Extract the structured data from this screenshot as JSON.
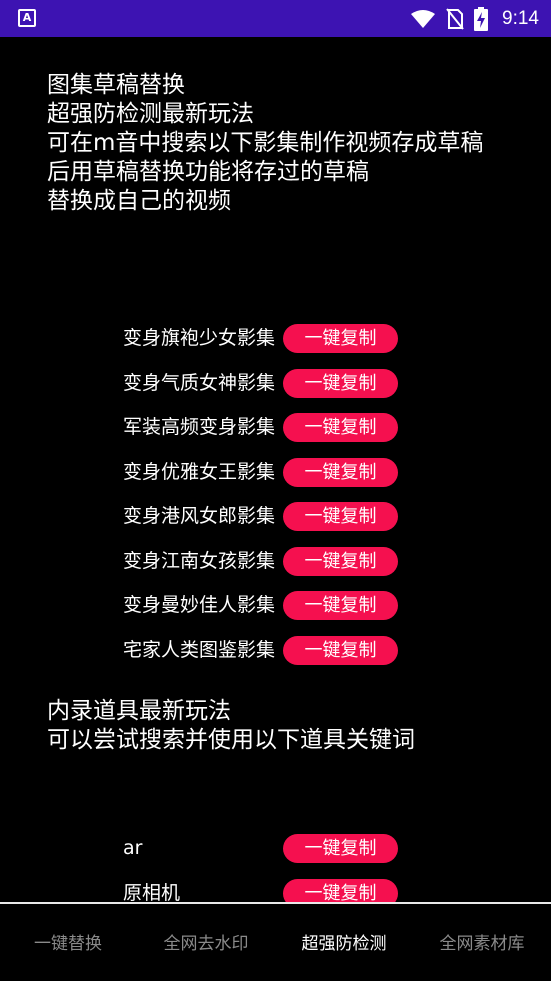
{
  "status_bar": {
    "app_icon_letter": "A",
    "time": "9:14",
    "background": "#3d13b2",
    "icons": [
      "wifi-icon",
      "no-sim-icon",
      "battery-charging-icon"
    ]
  },
  "intro_text": "图集草稿替换\n超强防检测最新玩法\n可在m音中搜索以下影集制作视频存成草稿\n后用草稿替换功能将存过的草稿\n替换成自己的视频",
  "album_rows": [
    {
      "label": "变身旗袍少女影集",
      "button": "一键复制"
    },
    {
      "label": "变身气质女神影集",
      "button": "一键复制"
    },
    {
      "label": "军装高频变身影集",
      "button": "一键复制"
    },
    {
      "label": "变身优雅女王影集",
      "button": "一键复制"
    },
    {
      "label": "变身港风女郎影集",
      "button": "一键复制"
    },
    {
      "label": "变身江南女孩影集",
      "button": "一键复制"
    },
    {
      "label": "变身曼妙佳人影集",
      "button": "一键复制"
    },
    {
      "label": "宅家人类图鉴影集",
      "button": "一键复制"
    }
  ],
  "section2_text": "内录道具最新玩法\n可以尝试搜索并使用以下道具关键词",
  "prop_rows": [
    {
      "label": "ar",
      "button": "一键复制"
    },
    {
      "label": "原相机",
      "button": "一键复制"
    }
  ],
  "bottom_nav": [
    {
      "label": "一键替换",
      "active": false
    },
    {
      "label": "全网去水印",
      "active": false
    },
    {
      "label": "超强防检测",
      "active": true
    },
    {
      "label": "全网素材库",
      "active": false
    }
  ],
  "colors": {
    "accent": "#f5104f",
    "nav_inactive": "#8a8a8a",
    "nav_active": "#ffffff"
  }
}
